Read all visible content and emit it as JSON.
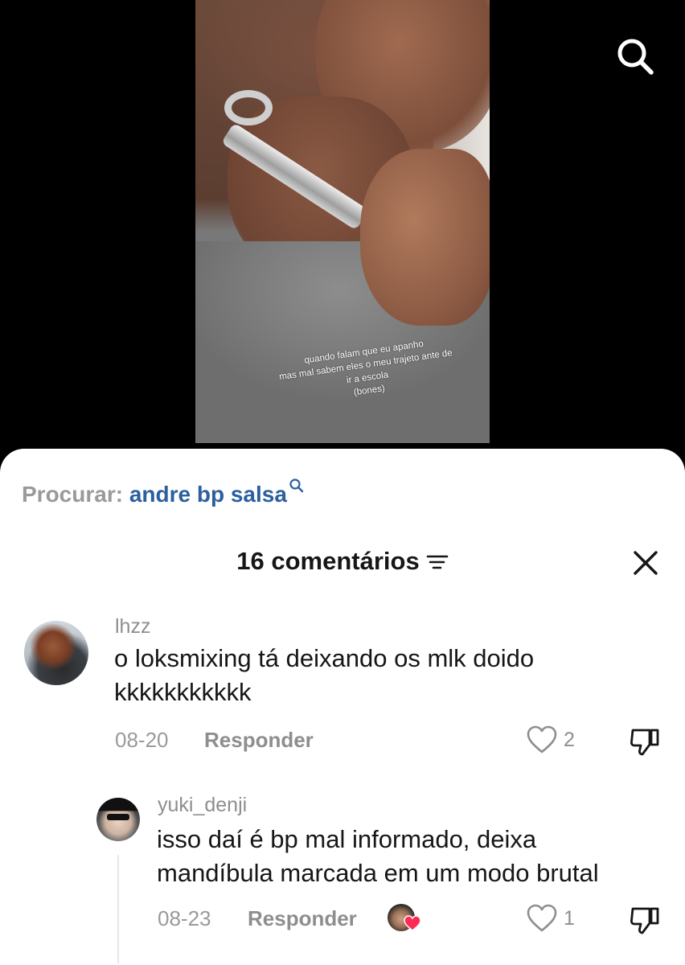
{
  "video": {
    "caption_lines": [
      "quando falam que eu apanho",
      "mas mal sabem eles o meu trajeto ante de",
      "ir a escola",
      "(bones)"
    ],
    "search_icon": "search-icon"
  },
  "sheet": {
    "search_prefix": "Procurar:",
    "search_term": "andre bp salsa",
    "comment_count_label": "16 comentários",
    "sort_icon": "sort-icon",
    "close_icon": "close-icon",
    "reply_label": "Responder"
  },
  "comments": [
    {
      "username": "lhzz",
      "text_line1": "o loksmixing tá deixando os mlk doido",
      "text_line2": "kkkkkkkkkkk",
      "date": "08-20",
      "likes": "2"
    },
    {
      "username": "yuki_denji",
      "text_line1": "isso daí é bp mal informado, deixa",
      "text_line2": "mandíbula marcada em um modo brutal",
      "date": "08-23",
      "likes": "1",
      "liked_by_creator": true
    }
  ],
  "colors": {
    "search_term": "#2b5f9e",
    "heart_red": "#fe2c55"
  }
}
